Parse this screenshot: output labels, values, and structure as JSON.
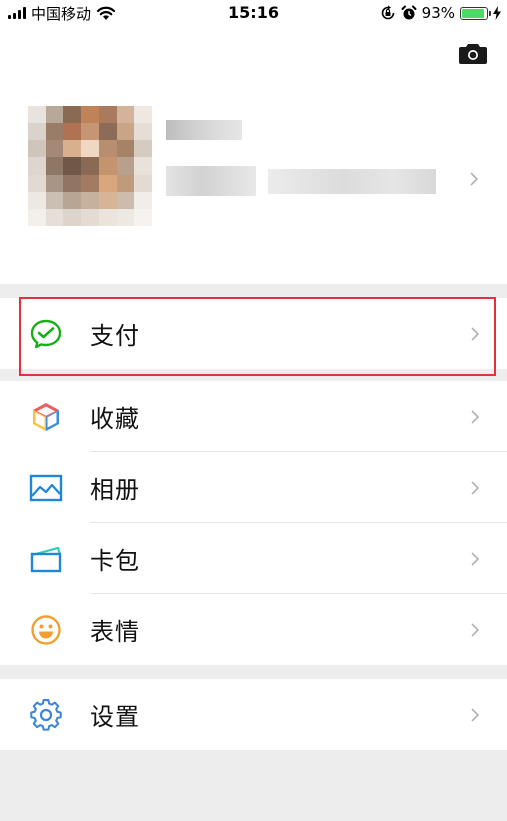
{
  "status_bar": {
    "carrier": "中国移动",
    "time": "15:16",
    "battery_percent": "93%",
    "battery_level": 0.93
  },
  "profile": {
    "camera_icon": "camera-icon",
    "chevron_icon": "chevron-right-icon"
  },
  "menu": {
    "pay": {
      "label": "支付",
      "icon": "wechat-pay-icon"
    },
    "favorites": {
      "label": "收藏",
      "icon": "favorites-cube-icon"
    },
    "album": {
      "label": "相册",
      "icon": "album-image-icon"
    },
    "cards": {
      "label": "卡包",
      "icon": "card-wallet-icon"
    },
    "stickers": {
      "label": "表情",
      "icon": "smiley-icon"
    },
    "settings": {
      "label": "设置",
      "icon": "gear-icon"
    }
  },
  "colors": {
    "highlight_border": "#e0333c",
    "pay_green": "#1aad19",
    "settings_blue": "#3b84d8",
    "album_blue": "#1f87d6",
    "smiley_orange": "#f0a033",
    "battery_green": "#4cd964"
  }
}
